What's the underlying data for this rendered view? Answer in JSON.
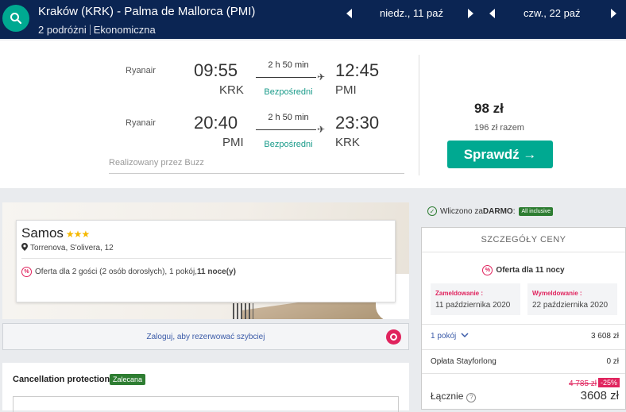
{
  "header": {
    "route": "Kraków (KRK) - Palma de Mallorca (PMI)",
    "travelers": "2 podróżni",
    "cabin": "Ekonomiczna",
    "depart_date": "niedz., 11 paź",
    "return_date": "czw., 22 paź"
  },
  "flights": [
    {
      "airline": "Ryanair",
      "dep_time": "09:55",
      "dep_code": "KRK",
      "duration": "2 h 50 min",
      "type": "Bezpośredni",
      "arr_time": "12:45",
      "arr_code": "PMI"
    },
    {
      "airline": "Ryanair",
      "dep_time": "20:40",
      "dep_code": "PMI",
      "duration": "2 h 50 min",
      "type": "Bezpośredni",
      "arr_time": "23:30",
      "arr_code": "KRK"
    }
  ],
  "operated_by": "Realizowany przez Buzz",
  "fare": {
    "price": "98 zł",
    "total": "196 zł razem",
    "cta": "Sprawdź →"
  },
  "hotel": {
    "name": "Samos",
    "stars": "★★★",
    "address": "Torrenova, S'olivera, 12",
    "offer_prefix": "Oferta dla 2 gości (2 osób dorosłych), 1 pokój, ",
    "offer_nights": "11 noce(y)"
  },
  "login_text": "Zaloguj, aby rezerwować szybciej",
  "cancellation": {
    "title": "Cancellation protection",
    "badge": "Zalecana"
  },
  "included": {
    "prefix": "Wliczono za ",
    "free": "DARMO",
    "suffix": " :",
    "badge": "All inclusive"
  },
  "price_details": {
    "title": "SZCZEGÓŁY CENY",
    "offer": "Oferta dla 11 nocy",
    "checkin_label": "Zameldowanie :",
    "checkin_date": "11 października 2020",
    "checkout_label": "Wymeldowanie :",
    "checkout_date": "22 października 2020",
    "rooms_label": "1 pokój",
    "rooms_price": "3 608 zł",
    "fee_label": "Opłata Stayforlong",
    "fee_value": "0 zł",
    "old_price": "4 785 zł",
    "discount": "-25%",
    "total_label": "Łącznie",
    "total_value": "3608 zł"
  },
  "colors": {
    "navy": "#0b2553",
    "teal": "#00a991",
    "pink": "#e0245e",
    "green": "#2e7d32"
  }
}
